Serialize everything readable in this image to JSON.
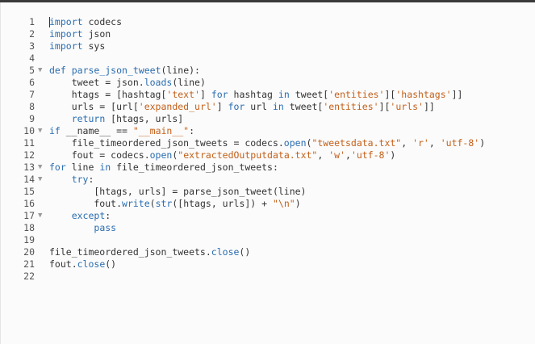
{
  "editor": {
    "lines": [
      {
        "num": "1",
        "fold": "",
        "tokens": [
          {
            "t": "import",
            "c": "kw"
          },
          {
            "t": " codecs",
            "c": ""
          }
        ]
      },
      {
        "num": "2",
        "fold": "",
        "tokens": [
          {
            "t": "import",
            "c": "kw"
          },
          {
            "t": " json",
            "c": ""
          }
        ]
      },
      {
        "num": "3",
        "fold": "",
        "tokens": [
          {
            "t": "import",
            "c": "kw"
          },
          {
            "t": " sys",
            "c": ""
          }
        ]
      },
      {
        "num": "4",
        "fold": "",
        "tokens": []
      },
      {
        "num": "5",
        "fold": "▼",
        "tokens": [
          {
            "t": "def",
            "c": "kw"
          },
          {
            "t": " ",
            "c": ""
          },
          {
            "t": "parse_json_tweet",
            "c": "fn"
          },
          {
            "t": "(line):",
            "c": ""
          }
        ]
      },
      {
        "num": "6",
        "fold": "",
        "tokens": [
          {
            "t": "    tweet = json.",
            "c": ""
          },
          {
            "t": "loads",
            "c": "fn"
          },
          {
            "t": "(line)",
            "c": ""
          }
        ]
      },
      {
        "num": "7",
        "fold": "",
        "tokens": [
          {
            "t": "    htags = [hashtag[",
            "c": ""
          },
          {
            "t": "'text'",
            "c": "str"
          },
          {
            "t": "] ",
            "c": ""
          },
          {
            "t": "for",
            "c": "kw"
          },
          {
            "t": " hashtag ",
            "c": ""
          },
          {
            "t": "in",
            "c": "kw"
          },
          {
            "t": " tweet[",
            "c": ""
          },
          {
            "t": "'entities'",
            "c": "str"
          },
          {
            "t": "][",
            "c": ""
          },
          {
            "t": "'hashtags'",
            "c": "str"
          },
          {
            "t": "]]",
            "c": ""
          }
        ]
      },
      {
        "num": "8",
        "fold": "",
        "tokens": [
          {
            "t": "    urls = [url[",
            "c": ""
          },
          {
            "t": "'expanded_url'",
            "c": "str"
          },
          {
            "t": "] ",
            "c": ""
          },
          {
            "t": "for",
            "c": "kw"
          },
          {
            "t": " url ",
            "c": ""
          },
          {
            "t": "in",
            "c": "kw"
          },
          {
            "t": " tweet[",
            "c": ""
          },
          {
            "t": "'entities'",
            "c": "str"
          },
          {
            "t": "][",
            "c": ""
          },
          {
            "t": "'urls'",
            "c": "str"
          },
          {
            "t": "]]",
            "c": ""
          }
        ]
      },
      {
        "num": "9",
        "fold": "",
        "tokens": [
          {
            "t": "    ",
            "c": ""
          },
          {
            "t": "return",
            "c": "kw"
          },
          {
            "t": " [htags, urls]",
            "c": ""
          }
        ]
      },
      {
        "num": "10",
        "fold": "▼",
        "tokens": [
          {
            "t": "if",
            "c": "kw"
          },
          {
            "t": " __name__ == ",
            "c": ""
          },
          {
            "t": "\"__main__\"",
            "c": "str"
          },
          {
            "t": ":",
            "c": ""
          }
        ]
      },
      {
        "num": "11",
        "fold": "",
        "tokens": [
          {
            "t": "    file_timeordered_json_tweets = codecs.",
            "c": ""
          },
          {
            "t": "open",
            "c": "fn"
          },
          {
            "t": "(",
            "c": ""
          },
          {
            "t": "\"tweetsdata.txt\"",
            "c": "str"
          },
          {
            "t": ", ",
            "c": ""
          },
          {
            "t": "'r'",
            "c": "str"
          },
          {
            "t": ", ",
            "c": ""
          },
          {
            "t": "'utf-8'",
            "c": "str"
          },
          {
            "t": ")",
            "c": ""
          }
        ]
      },
      {
        "num": "12",
        "fold": "",
        "tokens": [
          {
            "t": "    fout = codecs.",
            "c": ""
          },
          {
            "t": "open",
            "c": "fn"
          },
          {
            "t": "(",
            "c": ""
          },
          {
            "t": "\"extractedOutputdata.txt\"",
            "c": "str"
          },
          {
            "t": ", ",
            "c": ""
          },
          {
            "t": "'w'",
            "c": "str"
          },
          {
            "t": ",",
            "c": ""
          },
          {
            "t": "'utf-8'",
            "c": "str"
          },
          {
            "t": ")",
            "c": ""
          }
        ]
      },
      {
        "num": "13",
        "fold": "▼",
        "tokens": [
          {
            "t": "for",
            "c": "kw"
          },
          {
            "t": " line ",
            "c": ""
          },
          {
            "t": "in",
            "c": "kw"
          },
          {
            "t": " file_timeordered_json_tweets:",
            "c": ""
          }
        ]
      },
      {
        "num": "14",
        "fold": "▼",
        "tokens": [
          {
            "t": "    ",
            "c": ""
          },
          {
            "t": "try",
            "c": "kw"
          },
          {
            "t": ":",
            "c": ""
          }
        ]
      },
      {
        "num": "15",
        "fold": "",
        "tokens": [
          {
            "t": "        [htags, urls] = parse_json_tweet(line)",
            "c": ""
          }
        ]
      },
      {
        "num": "16",
        "fold": "",
        "tokens": [
          {
            "t": "        fout.",
            "c": ""
          },
          {
            "t": "write",
            "c": "fn"
          },
          {
            "t": "(",
            "c": ""
          },
          {
            "t": "str",
            "c": "fn"
          },
          {
            "t": "([htags, urls]) + ",
            "c": ""
          },
          {
            "t": "\"\\n\"",
            "c": "str"
          },
          {
            "t": ")",
            "c": ""
          }
        ]
      },
      {
        "num": "17",
        "fold": "▼",
        "tokens": [
          {
            "t": "    ",
            "c": ""
          },
          {
            "t": "except",
            "c": "kw"
          },
          {
            "t": ":",
            "c": ""
          }
        ]
      },
      {
        "num": "18",
        "fold": "",
        "tokens": [
          {
            "t": "        ",
            "c": ""
          },
          {
            "t": "pass",
            "c": "kw"
          }
        ]
      },
      {
        "num": "19",
        "fold": "",
        "tokens": []
      },
      {
        "num": "20",
        "fold": "",
        "tokens": [
          {
            "t": "file_timeordered_json_tweets.",
            "c": ""
          },
          {
            "t": "close",
            "c": "fn"
          },
          {
            "t": "()",
            "c": ""
          }
        ]
      },
      {
        "num": "21",
        "fold": "",
        "tokens": [
          {
            "t": "fout.",
            "c": ""
          },
          {
            "t": "close",
            "c": "fn"
          },
          {
            "t": "()",
            "c": ""
          }
        ]
      },
      {
        "num": "22",
        "fold": "",
        "tokens": []
      }
    ]
  }
}
